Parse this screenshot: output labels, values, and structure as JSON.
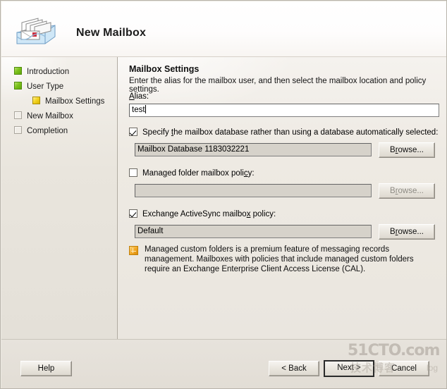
{
  "window": {
    "title": "New Mailbox",
    "icon": "mailbox-tray-icon"
  },
  "sidebar": {
    "items": [
      {
        "label": "Introduction",
        "state": "done",
        "indent": false
      },
      {
        "label": "User Type",
        "state": "done",
        "indent": false
      },
      {
        "label": "Mailbox Settings",
        "state": "current",
        "indent": true
      },
      {
        "label": "New Mailbox",
        "state": "todo",
        "indent": false
      },
      {
        "label": "Completion",
        "state": "todo",
        "indent": false
      }
    ]
  },
  "pane": {
    "title": "Mailbox Settings",
    "description": "Enter the alias for the mailbox user, and then select the mailbox location and policy settings.",
    "alias": {
      "label_prefix": "A",
      "label_rest": "lias:",
      "value": "test",
      "placeholder": ""
    },
    "options": [
      {
        "key": "specify_database",
        "checked": true,
        "label_a": "Specify ",
        "label_acc": "t",
        "label_b": "he mailbox database rather than using a database automatically selected:",
        "field_value": "Mailbox Database 1183032221",
        "field_disabled": false,
        "browse_a": "B",
        "browse_acc": "r",
        "browse_b": "owse...",
        "browse_disabled": false
      },
      {
        "key": "managed_folder_policy",
        "checked": false,
        "label_a": "Mana",
        "label_acc": "g",
        "label_b": "ed folder mailbox poli",
        "label_acc2": "c",
        "label_c": "y:",
        "field_value": "",
        "field_disabled": true,
        "browse_a": "B",
        "browse_acc": "r",
        "browse_b": "owse...",
        "browse_disabled": true
      },
      {
        "key": "activesync_policy",
        "checked": true,
        "label_a": "Exchan",
        "label_acc": "g",
        "label_b": "e ActiveSync mailbo",
        "label_acc2": "x",
        "label_c": " policy:",
        "field_value": "Default",
        "field_disabled": false,
        "browse_a": "B",
        "browse_acc": "r",
        "browse_b": "owse...",
        "browse_disabled": false
      }
    ],
    "note": {
      "icon": "info-note-icon",
      "text": "Managed custom folders is a premium feature of messaging records management. Mailboxes with policies that include managed custom folders require an Exchange Enterprise Client Access License (CAL)."
    }
  },
  "footer": {
    "help": "Help",
    "back": "< Back",
    "next": "Next >",
    "cancel": "Cancel"
  },
  "watermark": {
    "main": "51CTO.com",
    "sub": "技术博客",
    "tail": "log"
  },
  "colors": {
    "accent_done": "#7cc21c",
    "accent_current": "#f4d525",
    "note_icon": "#f0a623",
    "window_bg": "#ece9e2",
    "field_disabled": "#d6d2ca"
  }
}
